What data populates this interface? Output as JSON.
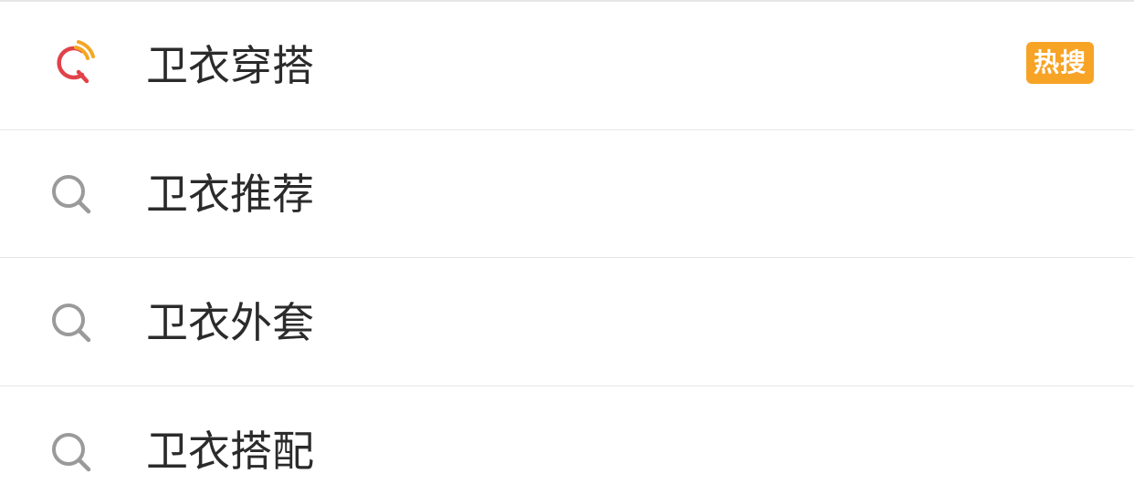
{
  "suggestions": [
    {
      "label": "卫衣穿搭",
      "icon": "hot-search-icon",
      "badge": "热搜"
    },
    {
      "label": "卫衣推荐",
      "icon": "search-icon"
    },
    {
      "label": "卫衣外套",
      "icon": "search-icon"
    },
    {
      "label": "卫衣搭配",
      "icon": "search-icon"
    }
  ],
  "colors": {
    "badge_bg": "#f7a325",
    "hot_icon_red": "#e0434a",
    "hot_icon_yellow": "#f5a623",
    "search_icon_gray": "#9a9a9a",
    "text": "#2b2b2b",
    "divider": "#e6e6e6"
  }
}
